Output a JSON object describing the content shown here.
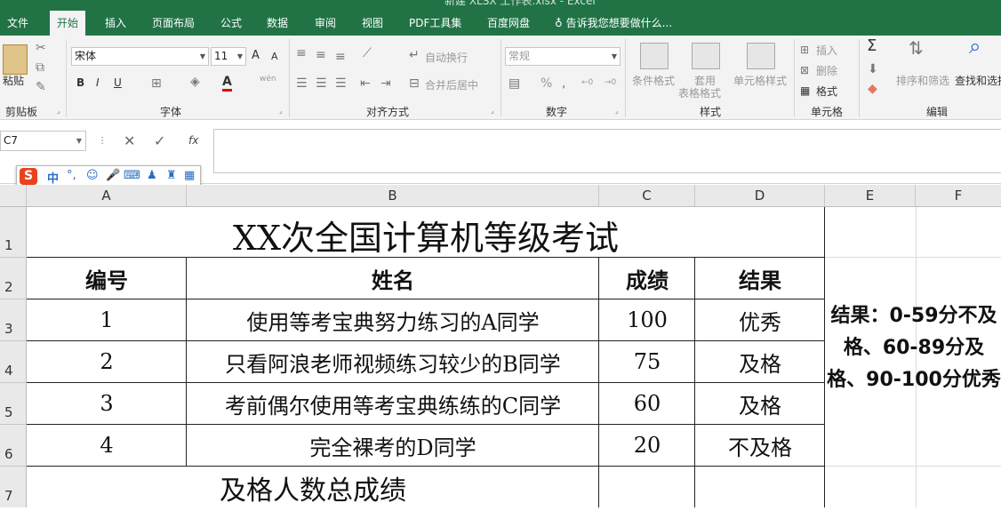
{
  "app": {
    "title": "新建 XLSX 工作表.xlsx - Excel"
  },
  "tabs": [
    "文件",
    "开始",
    "插入",
    "页面布局",
    "公式",
    "数据",
    "审阅",
    "视图",
    "PDF工具集",
    "百度网盘"
  ],
  "active_tab": "开始",
  "tell_me": "告诉我您想要做什么...",
  "ribbon": {
    "clipboard": {
      "paste": "粘贴",
      "label": "剪贴板"
    },
    "font": {
      "name": "宋体",
      "size": "11",
      "label": "字体",
      "bold": "B",
      "italic": "I",
      "underline": "U",
      "grow": "A",
      "shrink": "A",
      "phonetic": "wén"
    },
    "alignment": {
      "wrap": "自动换行",
      "merge": "合并后居中",
      "label": "对齐方式"
    },
    "number": {
      "format": "常规",
      "label": "数字",
      "percent": "%"
    },
    "styles": {
      "conditional": "条件格式",
      "table_line1": "套用",
      "table_line2": "表格格式",
      "cell_styles": "单元格样式",
      "label": "样式"
    },
    "cells": {
      "insert": "插入",
      "delete": "删除",
      "format": "格式",
      "label": "单元格"
    },
    "editing": {
      "sort": "排序和筛选",
      "find": "查找和选择",
      "label": "编辑"
    }
  },
  "formula_bar": {
    "name_box": "C7",
    "fx": "fx",
    "content": ""
  },
  "ime": {
    "lang": "中"
  },
  "columns": [
    "A",
    "B",
    "C",
    "D",
    "E",
    "F"
  ],
  "rows": [
    "1",
    "2",
    "3",
    "4",
    "5",
    "6",
    "7"
  ],
  "sheet": {
    "title": "XX次全国计算机等级考试",
    "headers": [
      "编号",
      "姓名",
      "成绩",
      "结果"
    ],
    "data": [
      [
        "1",
        "使用等考宝典努力练习的A同学",
        "100",
        "优秀"
      ],
      [
        "2",
        "只看阿浪老师视频练习较少的B同学",
        "75",
        "及格"
      ],
      [
        "3",
        "考前偶尔使用等考宝典练练的C同学",
        "60",
        "及格"
      ],
      [
        "4",
        "完全裸考的D同学",
        "20",
        "不及格"
      ]
    ],
    "summary_label": "及格人数总成绩",
    "note": "结果：0-59分不及格、60-89分及格、90-100分优秀"
  }
}
